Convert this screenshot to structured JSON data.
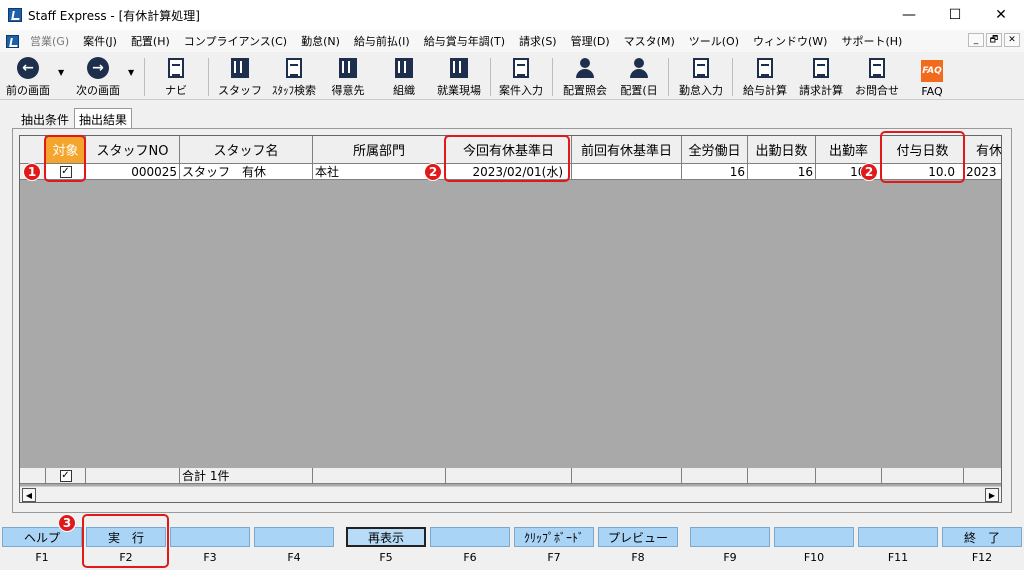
{
  "window": {
    "title": "Staff Express - [有休計算処理]",
    "minimize": "—",
    "maximize": "☐",
    "close": "✕"
  },
  "menu": [
    "営業(G)",
    "案件(J)",
    "配置(H)",
    "コンプライアンス(C)",
    "勤怠(N)",
    "給与前払(I)",
    "給与賞与年調(T)",
    "請求(S)",
    "管理(D)",
    "マスタ(M)",
    "ツール(O)",
    "ウィンドウ(W)",
    "サポート(H)"
  ],
  "mdi": [
    "_",
    "🗗",
    "✕"
  ],
  "toolbar": {
    "back": "前の画面",
    "forward": "次の画面",
    "navi": "ナビ",
    "staff": "スタッフ",
    "staff_search": "ｽﾀｯﾌ検索",
    "client": "得意先",
    "org": "組織",
    "site": "就業現場",
    "case_input": "案件入力",
    "assign_query": "配置照会",
    "assign_day": "配置(日",
    "attendance": "勤怠入力",
    "payroll": "給与計算",
    "billing": "請求計算",
    "inquiry": "お問合せ",
    "faq": "FAQ",
    "back_icon": "←",
    "forward_icon": "→",
    "dropdown_icon": "▼",
    "faq_icon": "FAQ"
  },
  "tabs": {
    "conditions": "抽出条件",
    "results": "抽出結果"
  },
  "grid": {
    "headers": [
      "対象",
      "スタッフNO",
      "スタッフ名",
      "所属部門",
      "今回有休基準日",
      "前回有休基準日",
      "全労働日",
      "出勤日数",
      "出勤率",
      "付与日数",
      "有休"
    ],
    "row1": {
      "index": "1",
      "checked": "✓",
      "staff_no": "000025",
      "name": "スタッフ　有休",
      "dept": "本社",
      "this_base": "2023/02/01(水)",
      "prev_base": "",
      "work_days": "16",
      "attend_days": "16",
      "rate": "100",
      "grant_days": "10.0",
      "next": "2023"
    },
    "footer": {
      "checked": "✓",
      "total": "合計 1件"
    }
  },
  "scroll": {
    "left": "◀",
    "right": "▶"
  },
  "fkeys": [
    {
      "label": "ヘルプ",
      "key": "F1"
    },
    {
      "label": "実　行",
      "key": "F2"
    },
    {
      "label": "",
      "key": "F3"
    },
    {
      "label": "",
      "key": "F4"
    },
    {
      "label": "再表示",
      "key": "F5"
    },
    {
      "label": "",
      "key": "F6"
    },
    {
      "label": "ｸﾘｯﾌﾟﾎﾞｰﾄﾞ",
      "key": "F7"
    },
    {
      "label": "プレビュー",
      "key": "F8"
    },
    {
      "label": "",
      "key": "F9"
    },
    {
      "label": "",
      "key": "F10"
    },
    {
      "label": "",
      "key": "F11"
    },
    {
      "label": "終　了",
      "key": "F12"
    }
  ],
  "annotations": {
    "b1": "1",
    "b2": "2",
    "b3": "2",
    "b4": "3"
  },
  "colors": {
    "highlight": "#e01a1a",
    "header_accent": "#f4a52e",
    "fkey": "#aad4f5"
  }
}
